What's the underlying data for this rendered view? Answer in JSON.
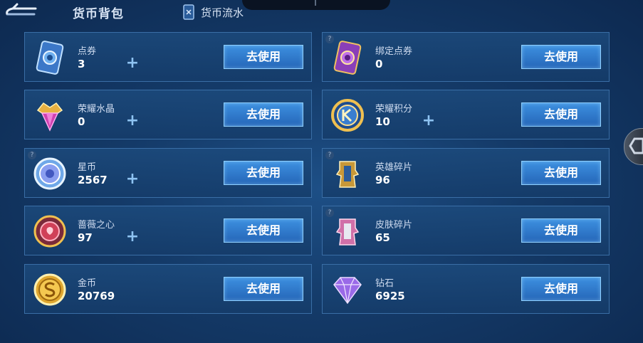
{
  "header": {
    "title": "货币背包",
    "flow_label": "货币流水",
    "back_icon": "back-arrow-icon"
  },
  "action_label": "去使用",
  "currencies": [
    {
      "name": "点券",
      "amount": "3",
      "icon": "ticket-icon",
      "has_plus": true,
      "has_help": false
    },
    {
      "name": "绑定点券",
      "amount": "0",
      "icon": "bound-ticket-icon",
      "has_plus": false,
      "has_help": true
    },
    {
      "name": "荣耀水晶",
      "amount": "0",
      "icon": "glory-crystal-icon",
      "has_plus": true,
      "has_help": false
    },
    {
      "name": "荣耀积分",
      "amount": "10",
      "icon": "glory-points-icon",
      "has_plus": true,
      "has_help": false
    },
    {
      "name": "星币",
      "amount": "2567",
      "icon": "star-coin-icon",
      "has_plus": true,
      "has_help": true
    },
    {
      "name": "英雄碎片",
      "amount": "96",
      "icon": "hero-fragment-icon",
      "has_plus": false,
      "has_help": true
    },
    {
      "name": "蔷薇之心",
      "amount": "97",
      "icon": "rose-heart-icon",
      "has_plus": true,
      "has_help": false
    },
    {
      "name": "皮肤碎片",
      "amount": "65",
      "icon": "skin-fragment-icon",
      "has_plus": false,
      "has_help": true
    },
    {
      "name": "金币",
      "amount": "20769",
      "icon": "gold-coin-icon",
      "has_plus": false,
      "has_help": false
    },
    {
      "name": "钻石",
      "amount": "6925",
      "icon": "diamond-icon",
      "has_plus": false,
      "has_help": false
    }
  ],
  "colors": {
    "background": "#143a68",
    "card_border": "#3a6ea6",
    "button": "#2f7bd0",
    "plus": "#8ec3f2"
  }
}
